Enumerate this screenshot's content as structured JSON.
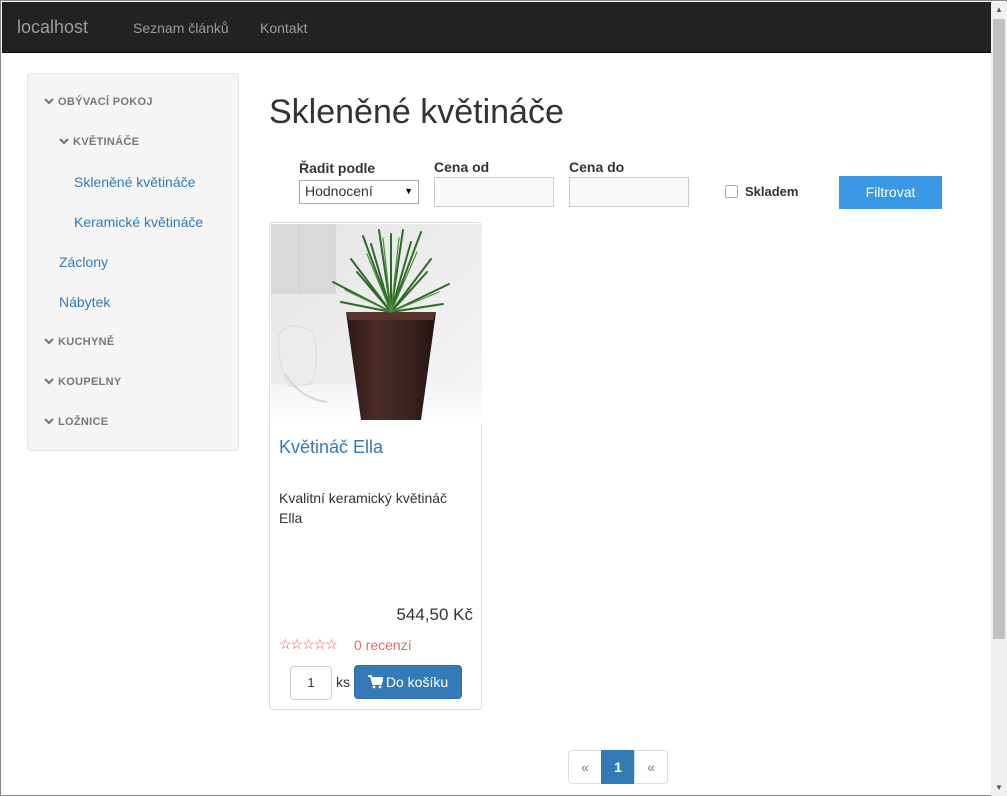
{
  "navbar": {
    "brand": "localhost",
    "links": [
      "Seznam článků",
      "Kontakt"
    ]
  },
  "sidebar": {
    "categories": [
      {
        "label": "OBÝVACÍ POKOJ",
        "type": "category"
      },
      {
        "label": "KVĚTINÁČE",
        "type": "category"
      },
      {
        "label": "Skleněné květináče",
        "type": "link"
      },
      {
        "label": "Keramické květináče",
        "type": "link"
      },
      {
        "label": "Záclony",
        "type": "link"
      },
      {
        "label": "Nábytek",
        "type": "link"
      },
      {
        "label": "KUCHYNĚ",
        "type": "category"
      },
      {
        "label": "KOUPELNY",
        "type": "category"
      },
      {
        "label": "LOŽNICE",
        "type": "category"
      }
    ]
  },
  "page": {
    "title": "Skleněné květináče"
  },
  "filters": {
    "sort_label": "Řadit podle",
    "sort_value": "Hodnocení",
    "price_from_label": "Cena od",
    "price_from_value": "",
    "price_to_label": "Cena do",
    "price_to_value": "",
    "in_stock_label": "Skladem",
    "in_stock_checked": false,
    "filter_button": "Filtrovat"
  },
  "products": [
    {
      "name": "Květináč Ella",
      "description": "Kvalitní keramický květináč Ella",
      "price": "544,50 Kč",
      "stars": "☆☆☆☆☆",
      "rating": 0,
      "reviews": "0 recenzí",
      "quantity": "1",
      "quantity_unit": "ks",
      "cart_button": "Do košíku"
    }
  ],
  "pagination": {
    "prev": "«",
    "current": "1",
    "next": "«"
  },
  "colors": {
    "navbar_bg": "#222222",
    "link": "#337ab7",
    "filter_button": "#3a97e5",
    "cart_button": "#337ab7",
    "stars": "#d9534f"
  },
  "icons": {
    "category_chevron": "chevron-down-icon",
    "cart": "shopping-cart-icon"
  }
}
